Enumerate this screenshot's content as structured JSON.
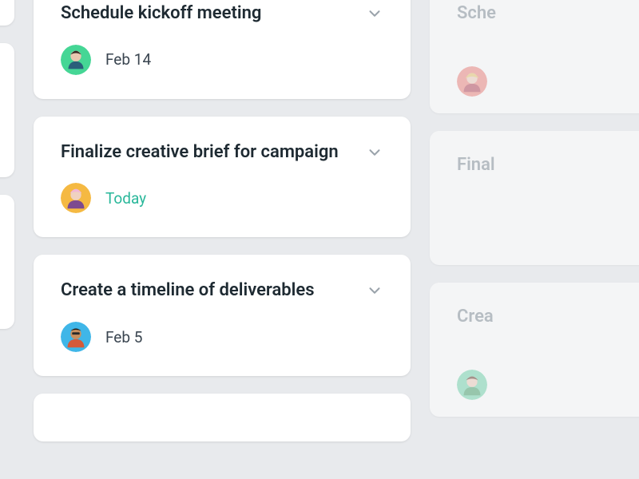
{
  "columns": {
    "left_partial": {
      "cards": [
        {
          "has_chevron": true
        },
        {
          "has_chevron": true
        },
        {
          "has_chevron": true
        }
      ]
    },
    "center": {
      "cards": [
        {
          "title": "Schedule kickoff meeting",
          "date": "Feb 14",
          "date_is_today": false,
          "avatar_bg": "#45d695",
          "avatar_icon": "person-1"
        },
        {
          "title": "Finalize creative brief for campaign",
          "date": "Today",
          "date_is_today": true,
          "avatar_bg": "#f5b942",
          "avatar_icon": "person-2"
        },
        {
          "title": "Create a timeline of deliverables",
          "date": "Feb 5",
          "date_is_today": false,
          "avatar_bg": "#3fb6e8",
          "avatar_icon": "person-3"
        }
      ]
    },
    "right_partial": {
      "cards": [
        {
          "title": "Sche",
          "avatar_bg": "#f08f88"
        },
        {
          "title": "Final"
        },
        {
          "title": "Crea",
          "avatar_bg": "#7fd9b3"
        }
      ]
    }
  }
}
